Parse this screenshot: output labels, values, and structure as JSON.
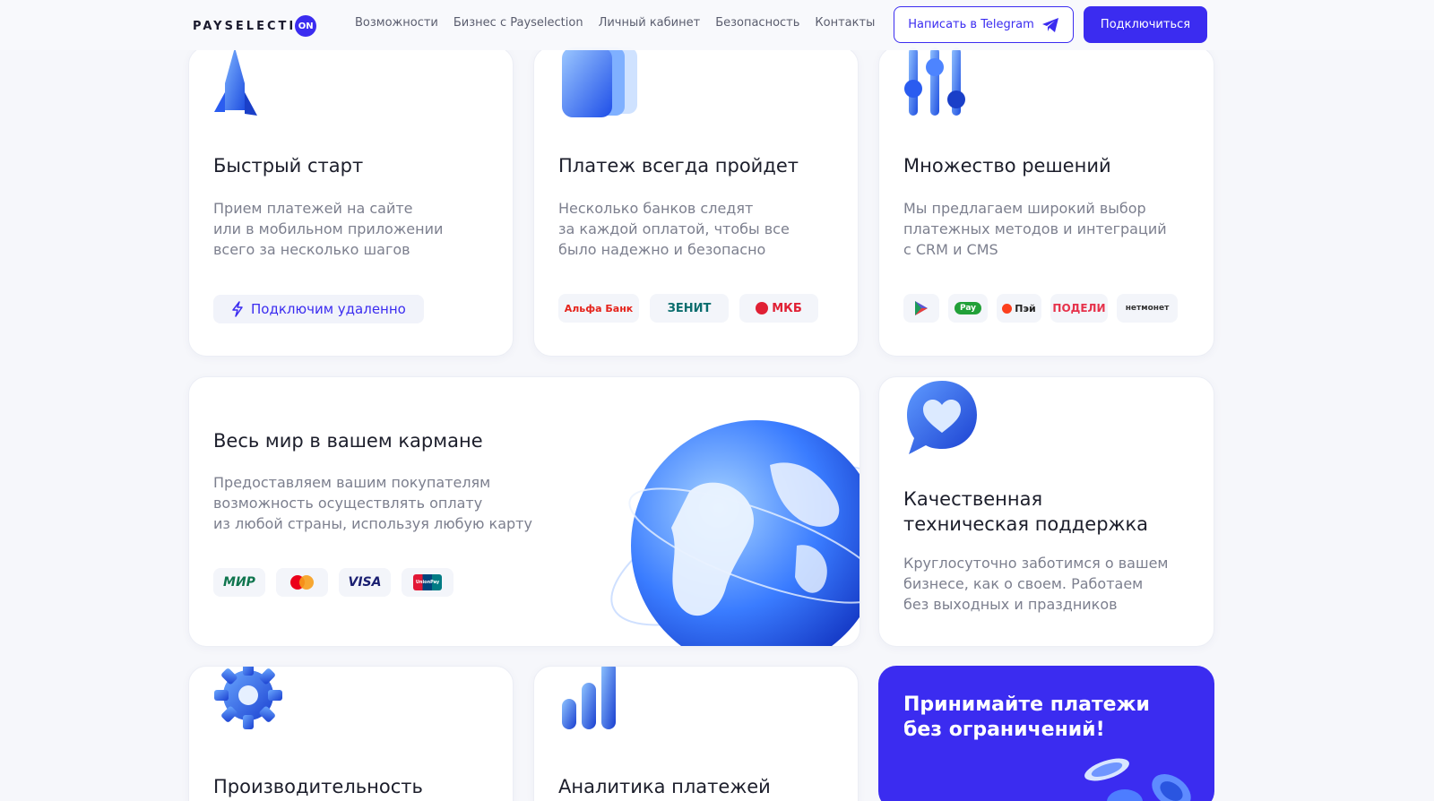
{
  "brand": {
    "name": "PAYSELECTI",
    "suffix": "ON"
  },
  "nav": [
    {
      "label": "Возможности"
    },
    {
      "label": "Бизнес с Payselection"
    },
    {
      "label": "Личный кабинет"
    },
    {
      "label": "Безопасность"
    },
    {
      "label": "Контакты"
    }
  ],
  "actions": {
    "telegram_label": "Написать в Telegram",
    "connect_label": "Подключиться"
  },
  "colors": {
    "accent": "#3b2cf0",
    "card_bg": "#ffffff",
    "page_bg": "#f6f7fb",
    "muted_text": "#7c7f8e"
  },
  "cards": {
    "fast_start": {
      "icon": "rocket-icon",
      "title": "Быстрый старт",
      "lines": [
        "Прием платежей на сайте",
        "или в мобильном приложении",
        "всего за несколько шагов"
      ],
      "button_label": "Подключим удаленно"
    },
    "payment": {
      "icon": "cards-stack-icon",
      "title": "Платеж всегда пройдет",
      "lines": [
        "Несколько банков следят",
        "за каждой оплатой, чтобы все",
        "было надежно и безопасно"
      ],
      "banks": [
        "Альфа Банк",
        "ЗЕНИТ",
        "МКБ"
      ]
    },
    "solutions": {
      "icon": "sliders-icon",
      "title": "Множество решений",
      "lines": [
        "Мы предлагаем широкий выбор",
        "платежных методов и интеграций",
        "с CRM и CMS"
      ],
      "methods": [
        "",
        "Pay",
        "Пэй",
        "ПОДЕЛИ",
        "нетмонет"
      ]
    },
    "world": {
      "icon": "globe-icon",
      "title": "Весь мир в вашем кармане",
      "lines": [
        "Предоставляем вашим покупателям",
        "возможность осуществлять оплату",
        "из любой страны, используя любую карту"
      ],
      "cards_list": [
        "МИР",
        "",
        "VISA",
        "UnionPay"
      ]
    },
    "support": {
      "icon": "heart-chat-icon",
      "title_lines": [
        "Качественная",
        "техническая поддержка"
      ],
      "lines": [
        "Круглосуточно заботимся о вашем",
        "бизнесе, как о своем. Работаем",
        "без выходных и праздников"
      ]
    },
    "performance": {
      "icon": "gear-icon",
      "title": "Производительность"
    },
    "analytics": {
      "icon": "bar-chart-icon",
      "title": "Аналитика платежей"
    },
    "promo": {
      "title_lines": [
        "Принимайте платежи",
        "без ограничений!"
      ]
    }
  }
}
